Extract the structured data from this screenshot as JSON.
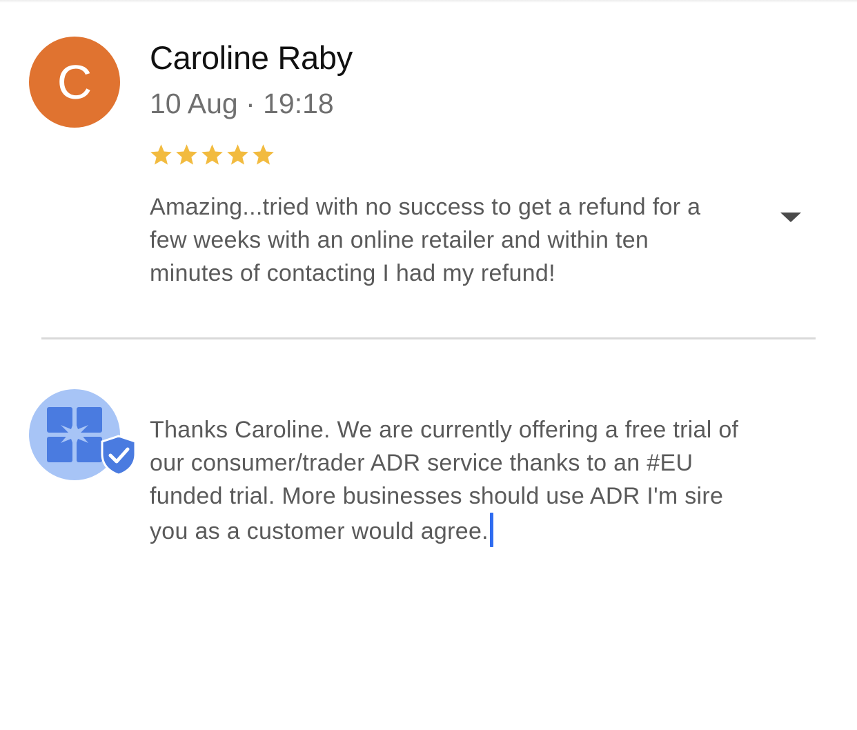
{
  "review": {
    "avatar_letter": "C",
    "avatar_color": "#e07330",
    "reviewer_name": "Caroline Raby",
    "date": "10 Aug · 19:18",
    "rating": 5,
    "rating_max": 5,
    "star_color": "#f2bb3f",
    "text": "Amazing...tried with no success to get a refund for a few weeks with an online retailer and within ten minutes of contacting I had my refund!",
    "expand_icon": "caret-down-icon"
  },
  "reply": {
    "avatar_icon": "business-logo-icon",
    "verified_icon": "verified-shield-icon",
    "accent_color": "#4a7be0",
    "text": "Thanks Caroline. We are currently offering a free trial of our consumer/trader ADR service thanks to an #EU funded trial. More businesses should use ADR I'm sire you as a customer would agree."
  }
}
